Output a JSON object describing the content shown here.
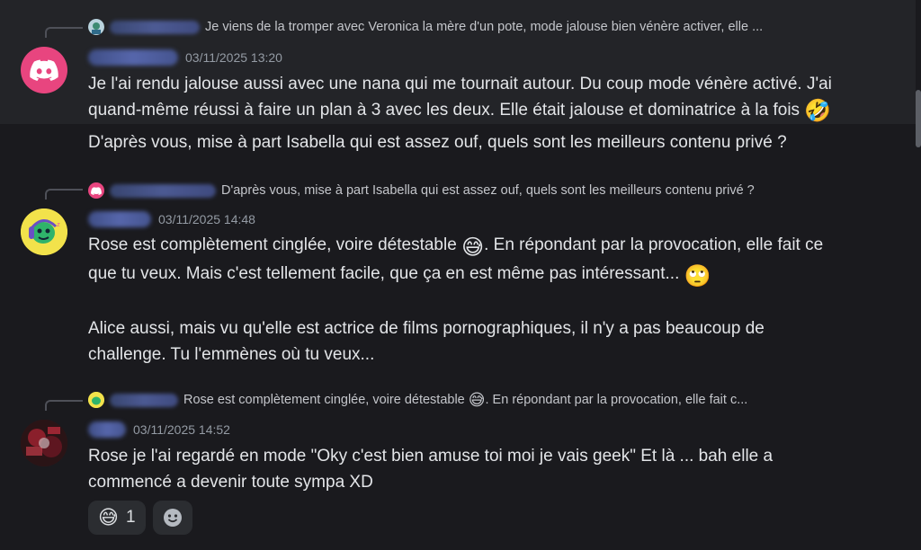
{
  "messages": [
    {
      "reply_preview": "Je viens de la tromper avec Veronica la mère d'un pote,  mode jalouse bien vénère  activer, elle ...",
      "timestamp": "03/11/2025 13:20",
      "paragraphs": [
        "Je l'ai rendu jalouse aussi avec une nana qui me tournait autour. Du coup mode vénère activé. J'ai",
        "quand-même réussi à faire un plan à 3 avec les deux. Elle était jalouse et dominatrice à la fois",
        "D'après vous, mise à part Isabella qui est assez ouf, quels sont les meilleurs contenu privé ?"
      ],
      "emoji": "🤣"
    },
    {
      "reply_preview": "D'après vous, mise à part Isabella qui est assez ouf, quels sont les meilleurs contenu privé ?",
      "timestamp": "03/11/2025 14:48",
      "line1_a": "Rose est complètement cinglée, voire détestable",
      "line1_b": ". En répondant par la provocation, elle fait ce",
      "line2": "que tu veux. Mais c'est tellement facile, que ça en est même pas intéressant...",
      "line3": "Alice aussi, mais vu qu'elle est actrice de films pornographiques, il n'y a pas beaucoup de",
      "line4": "challenge. Tu l'emmènes où tu veux...",
      "emoji_a": "😅",
      "emoji_b": "🙄"
    },
    {
      "reply_preview_a": "Rose est complètement cinglée, voire détestable",
      "reply_preview_b": ". En répondant par la provocation, elle fait c...",
      "timestamp": "03/11/2025 14:52",
      "line1": "Rose je l'ai regardé en mode \"Oky c'est bien amuse toi moi je vais geek\" Et là ... bah elle a",
      "line2": "commencé a devenir toute sympa XD",
      "reaction": {
        "emoji": "😅",
        "count": "1"
      }
    }
  ],
  "colors": {
    "discord": "#e8457f",
    "background": "#1a1a1e",
    "highlight": "#232428"
  },
  "icons": [
    "discord-logo-icon",
    "green-character-icon",
    "add-reaction-smile-icon"
  ]
}
